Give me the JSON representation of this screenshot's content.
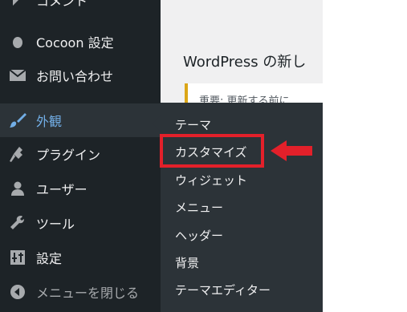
{
  "sidebar": {
    "items": [
      {
        "id": "comments",
        "label": "コメント",
        "icon": "comment-icon"
      },
      {
        "id": "cocoon",
        "label": "Cocoon 設定",
        "icon": "circle-icon"
      },
      {
        "id": "contact",
        "label": "お問い合わせ",
        "icon": "mail-icon"
      },
      {
        "id": "appearance",
        "label": "外観",
        "icon": "paintbrush-icon",
        "active": true
      },
      {
        "id": "plugins",
        "label": "プラグイン",
        "icon": "plugin-icon"
      },
      {
        "id": "users",
        "label": "ユーザー",
        "icon": "user-icon"
      },
      {
        "id": "tools",
        "label": "ツール",
        "icon": "wrench-icon"
      },
      {
        "id": "settings",
        "label": "設定",
        "icon": "settings-icon"
      },
      {
        "id": "collapse",
        "label": "メニューを閉じる",
        "icon": "collapse-arrow-icon"
      }
    ]
  },
  "submenu": {
    "items": [
      "テーマ",
      "カスタマイズ",
      "ウィジェット",
      "メニュー",
      "ヘッダー",
      "背景",
      "テーマエディター"
    ],
    "highlighted": "カスタマイズ"
  },
  "main": {
    "heading": "WordPress の新し",
    "notice_text": "重要: 更新する前に"
  },
  "colors": {
    "sidebar_bg": "#1d2327",
    "submenu_bg": "#2c3338",
    "active_text": "#72aee6",
    "highlight_red": "#e3202a"
  }
}
